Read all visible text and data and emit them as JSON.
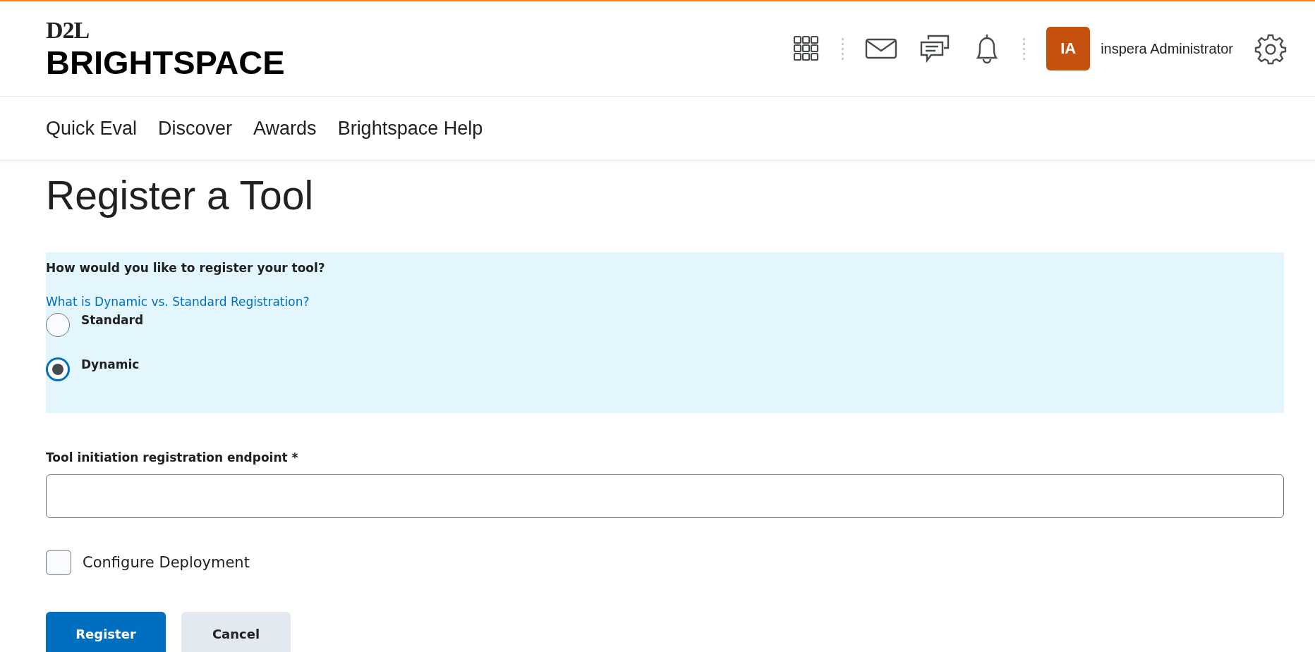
{
  "header": {
    "logo_top": "D2L",
    "logo_main": "BRIGHTSPACE",
    "avatar_initials": "IA",
    "user_name": "inspera Administrator"
  },
  "nav": [
    {
      "label": "Quick Eval"
    },
    {
      "label": "Discover"
    },
    {
      "label": "Awards"
    },
    {
      "label": "Brightspace Help"
    }
  ],
  "page_title": "Register a Tool",
  "registration": {
    "question": "How would you like to register your tool?",
    "help_link": "What is Dynamic vs. Standard Registration?",
    "options": [
      {
        "label": "Standard",
        "selected": false
      },
      {
        "label": "Dynamic",
        "selected": true
      }
    ]
  },
  "endpoint_field": {
    "label": "Tool initiation registration endpoint *"
  },
  "configure_deployment": {
    "label": "Configure Deployment",
    "checked": false
  },
  "buttons": [
    {
      "label": "Register",
      "kind": "primary"
    },
    {
      "label": "Cancel",
      "kind": "secondary"
    }
  ]
}
